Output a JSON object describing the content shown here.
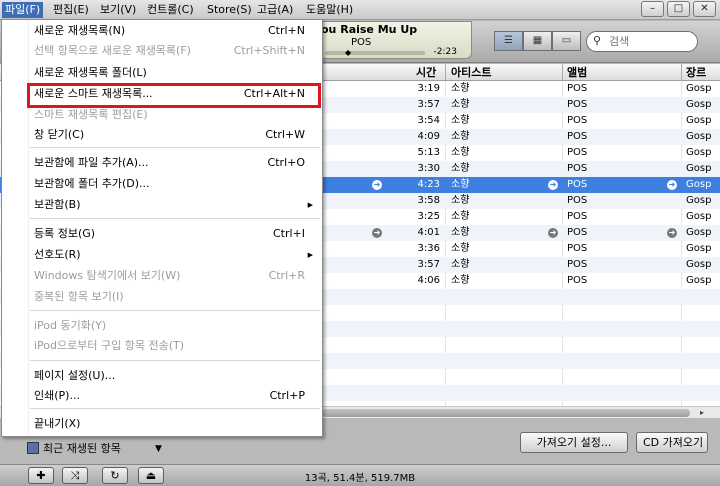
{
  "menubar": {
    "items": [
      "파일(F)",
      "편집(E)",
      "보기(V)",
      "컨트롤(C)",
      "Store(S)",
      "고급(A)",
      "도움말(H)"
    ],
    "window_buttons": [
      "–",
      "□",
      "✕"
    ]
  },
  "player": {
    "song_title": "ou Raise Mu Up",
    "album": "POS",
    "remaining": "-2:23"
  },
  "search": {
    "placeholder": "검색"
  },
  "table": {
    "headers": {
      "time": "시간",
      "artist": "아티스트",
      "album": "앨범",
      "genre": "장르"
    },
    "rows": [
      {
        "time": "3:19",
        "artist": "소향",
        "album": "POS",
        "genre": "Gosp"
      },
      {
        "time": "3:57",
        "artist": "소향",
        "album": "POS",
        "genre": "Gosp"
      },
      {
        "time": "3:54",
        "artist": "소향",
        "album": "POS",
        "genre": "Gosp"
      },
      {
        "time": "4:09",
        "artist": "소향",
        "album": "POS",
        "genre": "Gosp"
      },
      {
        "time": "5:13",
        "artist": "소향",
        "album": "POS",
        "genre": "Gosp"
      },
      {
        "time": "3:30",
        "artist": "소향",
        "album": "POS",
        "genre": "Gosp"
      },
      {
        "time": "4:23",
        "artist": "소향",
        "album": "POS",
        "genre": "Gosp"
      },
      {
        "time": "3:58",
        "artist": "소향",
        "album": "POS",
        "genre": "Gosp"
      },
      {
        "time": "3:25",
        "artist": "소향",
        "album": "POS",
        "genre": "Gosp"
      },
      {
        "time": "4:01",
        "artist": "소향",
        "album": "POS",
        "genre": "Gosp"
      },
      {
        "time": "3:36",
        "artist": "소향",
        "album": "POS",
        "genre": "Gosp"
      },
      {
        "time": "3:57",
        "artist": "소향",
        "album": "POS",
        "genre": "Gosp"
      },
      {
        "time": "4:06",
        "artist": "소향",
        "album": "POS",
        "genre": "Gosp"
      }
    ]
  },
  "file_menu": {
    "items": [
      {
        "label": "새로운 재생목록(N)",
        "shortcut": "Ctrl+N"
      },
      {
        "label": "선택 항목으로 새로운 재생목록(F)",
        "shortcut": "Ctrl+Shift+N"
      },
      {
        "label": "새로운 재생목록 폴더(L)",
        "shortcut": ""
      },
      {
        "label": "새로운 스마트 재생목록...",
        "shortcut": "Ctrl+Alt+N"
      },
      {
        "label": "스마트 재생목록 편집(E)",
        "shortcut": ""
      },
      {
        "label": "창 닫기(C)",
        "shortcut": "Ctrl+W"
      },
      {
        "label": "보관함에 파일 추가(A)...",
        "shortcut": "Ctrl+O"
      },
      {
        "label": "보관함에 폴더 추가(D)...",
        "shortcut": ""
      },
      {
        "label": "보관함(B)",
        "shortcut": ""
      },
      {
        "label": "등록 정보(G)",
        "shortcut": "Ctrl+I"
      },
      {
        "label": "선호도(R)",
        "shortcut": ""
      },
      {
        "label": "Windows 탐색기에서 보기(W)",
        "shortcut": "Ctrl+R"
      },
      {
        "label": "중복된 항목 보기(I)",
        "shortcut": ""
      },
      {
        "label": "iPod 동기화(Y)",
        "shortcut": ""
      },
      {
        "label": "iPod으로부터 구입 항목 전송(T)",
        "shortcut": ""
      },
      {
        "label": "페이지 설정(U)...",
        "shortcut": ""
      },
      {
        "label": "인쇄(P)...",
        "shortcut": "Ctrl+P"
      },
      {
        "label": "끝내기(X)",
        "shortcut": ""
      }
    ]
  },
  "bottom": {
    "recent_label": "최근 재생된 항목",
    "import_settings": "가져오기 설정...",
    "import_cd": "CD 가져오기",
    "status": "13곡, 51.4분, 519.7MB"
  },
  "colors": {
    "selection": "#3d80df",
    "highlight_box": "#e0141e",
    "menu_active": "#3d6db5"
  }
}
